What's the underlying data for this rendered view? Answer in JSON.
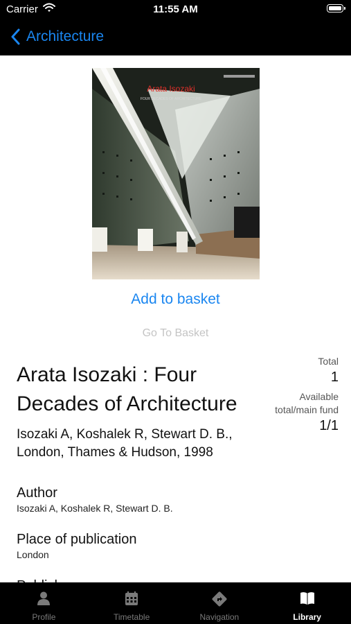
{
  "status_bar": {
    "carrier": "Carrier",
    "time": "11:55 AM"
  },
  "nav": {
    "back_label": "Architecture"
  },
  "cover": {
    "title": "Arata Isozaki",
    "subtitle": "FOUR DECADES OF ARCHITECTURE"
  },
  "actions": {
    "add_to_basket": "Add to basket",
    "go_to_basket": "Go To Basket"
  },
  "book": {
    "title": "Arata Isozaki : Four Decades of Architecture",
    "summary": "Isozaki A, Koshalek R, Stewart D. B., London, Thames & Hudson, 1998"
  },
  "stats": {
    "total_label": "Total",
    "total_value": "1",
    "available_label": "Available total/main fund",
    "available_value": "1/1"
  },
  "fields": [
    {
      "label": "Author",
      "value": "Isozaki A, Koshalek R, Stewart D. B."
    },
    {
      "label": "Place of publication",
      "value": "London"
    },
    {
      "label": "Publisher",
      "value": ""
    }
  ],
  "tabs": [
    {
      "label": "Profile",
      "icon": "person-icon"
    },
    {
      "label": "Timetable",
      "icon": "calendar-icon"
    },
    {
      "label": "Navigation",
      "icon": "directions-icon"
    },
    {
      "label": "Library",
      "icon": "book-icon"
    }
  ],
  "colors": {
    "accent": "#1a86f0",
    "bar": "#000000",
    "disabled": "#c4c4c4"
  }
}
